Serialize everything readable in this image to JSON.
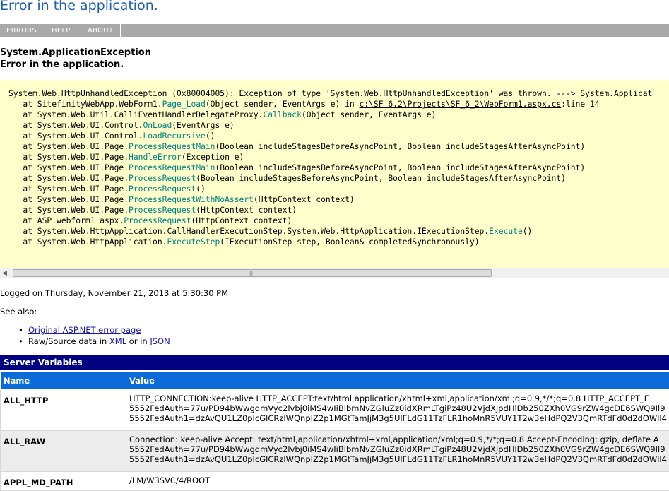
{
  "page_title": "Error in the application.",
  "nav": {
    "errors": "ERRORS",
    "help": "HELP",
    "about": "ABOUT"
  },
  "exception": {
    "type": "System.ApplicationException",
    "message": "Error in the application."
  },
  "trace": {
    "header": "System.Web.HttpUnhandledException (0x80004005): Exception of type 'System.Web.HttpUnhandledException' was thrown. ---> System.Applicat",
    "frames": [
      {
        "at": "at ",
        "ns": "SitefinityWebApp.WebForm1.",
        "method": "Page_Load",
        "params": "(Object sender, EventArgs e)",
        "tail": " in ",
        "file": "c:\\SF 6.2\\Projects\\SF_6_2\\WebForm1.aspx.cs",
        "line": ":line 14"
      },
      {
        "at": "at ",
        "ns": "System.Web.Util.CalliEventHandlerDelegateProxy.",
        "method": "Callback",
        "params": "(Object sender, EventArgs e)"
      },
      {
        "at": "at ",
        "ns": "System.Web.UI.Control.",
        "method": "OnLoad",
        "params": "(EventArgs e)"
      },
      {
        "at": "at ",
        "ns": "System.Web.UI.Control.",
        "method": "LoadRecursive",
        "params": "()"
      },
      {
        "at": "at ",
        "ns": "System.Web.UI.Page.",
        "method": "ProcessRequestMain",
        "params": "(Boolean includeStagesBeforeAsyncPoint, Boolean includeStagesAfterAsyncPoint)"
      },
      {
        "at": "at ",
        "ns": "System.Web.UI.Page.",
        "method": "HandleError",
        "params": "(Exception e)"
      },
      {
        "at": "at ",
        "ns": "System.Web.UI.Page.",
        "method": "ProcessRequestMain",
        "params": "(Boolean includeStagesBeforeAsyncPoint, Boolean includeStagesAfterAsyncPoint)"
      },
      {
        "at": "at ",
        "ns": "System.Web.UI.Page.",
        "method": "ProcessRequest",
        "params": "(Boolean includeStagesBeforeAsyncPoint, Boolean includeStagesAfterAsyncPoint)"
      },
      {
        "at": "at ",
        "ns": "System.Web.UI.Page.",
        "method": "ProcessRequest",
        "params": "()"
      },
      {
        "at": "at ",
        "ns": "System.Web.UI.Page.",
        "method": "ProcessRequestWithNoAssert",
        "params": "(HttpContext context)"
      },
      {
        "at": "at ",
        "ns": "System.Web.UI.Page.",
        "method": "ProcessRequest",
        "params": "(HttpContext context)"
      },
      {
        "at": "at ",
        "ns": "ASP.webform1_aspx.",
        "method": "ProcessRequest",
        "params": "(HttpContext context)"
      },
      {
        "at": "at ",
        "ns": "System.Web.HttpApplication.CallHandlerExecutionStep.System.Web.HttpApplication.IExecutionStep.",
        "method": "Execute",
        "params": "()"
      },
      {
        "at": "at ",
        "ns": "System.Web.HttpApplication.",
        "method": "ExecuteStep",
        "params": "(IExecutionStep step, Boolean& completedSynchronously)"
      }
    ]
  },
  "logged": "Logged on Thursday, November 21, 2013 at 5:30:30 PM",
  "see_also": {
    "label": "See also:",
    "original_link": "Original ASP.NET error page",
    "raw_prefix": "Raw/Source data in ",
    "xml_link": "XML",
    "or_in": " or in ",
    "json_link": "JSON"
  },
  "server_variables": {
    "title": "Server Variables",
    "columns": [
      "Name",
      "Value"
    ],
    "rows": [
      {
        "name": "ALL_HTTP",
        "lines": [
          "HTTP_CONNECTION:keep-alive HTTP_ACCEPT:text/html,application/xhtml+xml,application/xml;q=0.9,*/*;q=0.8 HTTP_ACCEPT_E",
          "5552FedAuth=77u/PD94bWwgdmVyc2lvbj0iMS4wIiBlbmNvZGluZz0idXRmLTgiPz48U2VjdXJpdHlDb250ZXh0VG9rZW4gcDE6SWQ9Il9",
          "5552FedAuth1=dzAvQU1LZ0pIcGlCRzlWQnpIZ2p1MGtTamJjM3g5UlFLdG11TzFLR1hoMnR5VUY1T2w3eHdPQ2V3QmRTdFd0d2dOWll4"
        ]
      },
      {
        "name": "ALL_RAW",
        "lines": [
          "Connection: keep-alive Accept: text/html,application/xhtml+xml,application/xml;q=0.9,*/*;q=0.8 Accept-Encoding: gzip, deflate A",
          "5552FedAuth=77u/PD94bWwgdmVyc2lvbj0iMS4wIiBlbmNvZGluZz0idXRmLTgiPz48U2VjdXJpdHlDb250ZXh0VG9rZW4gcDE6SWQ9Il9",
          "5552FedAuth1=dzAvQU1LZ0pIcGlCRzlWQnpIZ2p1MGtTamJjM3g5UlFLdG11TzFLR1hoMnR5VUY1T2w3eHdPQ2V3QmRTdFd0d2dOWll4"
        ]
      },
      {
        "name": "APPL_MD_PATH",
        "lines": [
          "/LM/W3SVC/4/ROOT"
        ]
      }
    ]
  },
  "colors": {
    "title": "#1f5fb0",
    "nav_bg": "#a9a9a9",
    "trace_bg": "#ffffcc",
    "method": "#008080",
    "section_header": "#000080",
    "table_header": "#0b6bd8"
  }
}
